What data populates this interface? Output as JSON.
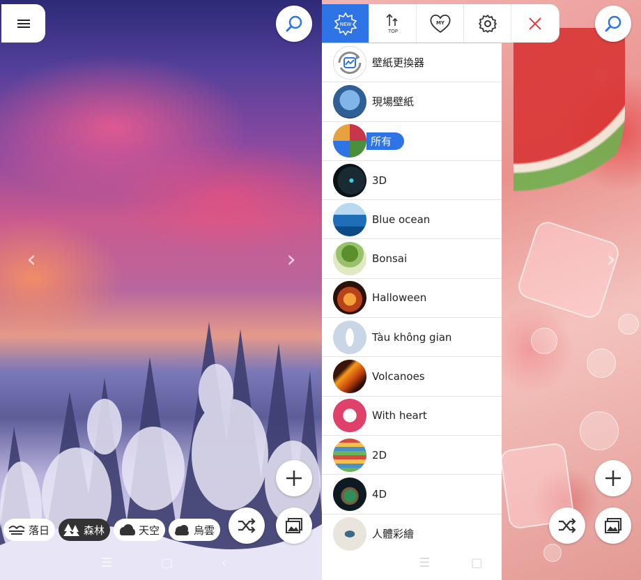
{
  "left_screen": {
    "categories": [
      {
        "label": "落日",
        "icon": "sunset-icon",
        "active": false
      },
      {
        "label": "森林",
        "icon": "forest-icon",
        "active": true
      },
      {
        "label": "天空",
        "icon": "sky-icon",
        "active": false
      },
      {
        "label": "烏雲",
        "icon": "dark-cloud-icon",
        "active": false
      }
    ]
  },
  "right_screen": {
    "tabs": [
      {
        "name": "new-tab",
        "label": "NEW",
        "active": true
      },
      {
        "name": "top-tab",
        "label": "TOP",
        "active": false
      },
      {
        "name": "my-tab",
        "label": "MY",
        "active": false
      },
      {
        "name": "settings-tab",
        "label": "",
        "active": false
      }
    ],
    "menu_items": [
      {
        "label": "壁紙更換器",
        "selected": false
      },
      {
        "label": "現場壁紙",
        "selected": false
      },
      {
        "label": "所有",
        "selected": true
      },
      {
        "label": "3D",
        "selected": false
      },
      {
        "label": "Blue ocean",
        "selected": false
      },
      {
        "label": "Bonsai",
        "selected": false
      },
      {
        "label": "Halloween",
        "selected": false
      },
      {
        "label": "Tàu không gian",
        "selected": false
      },
      {
        "label": "Volcanoes",
        "selected": false
      },
      {
        "label": "With heart",
        "selected": false
      },
      {
        "label": "2D",
        "selected": false
      },
      {
        "label": "4D",
        "selected": false
      },
      {
        "label": "人體彩繪",
        "selected": false
      }
    ]
  },
  "colors": {
    "accent": "#2f74e6",
    "close": "#e53935"
  }
}
